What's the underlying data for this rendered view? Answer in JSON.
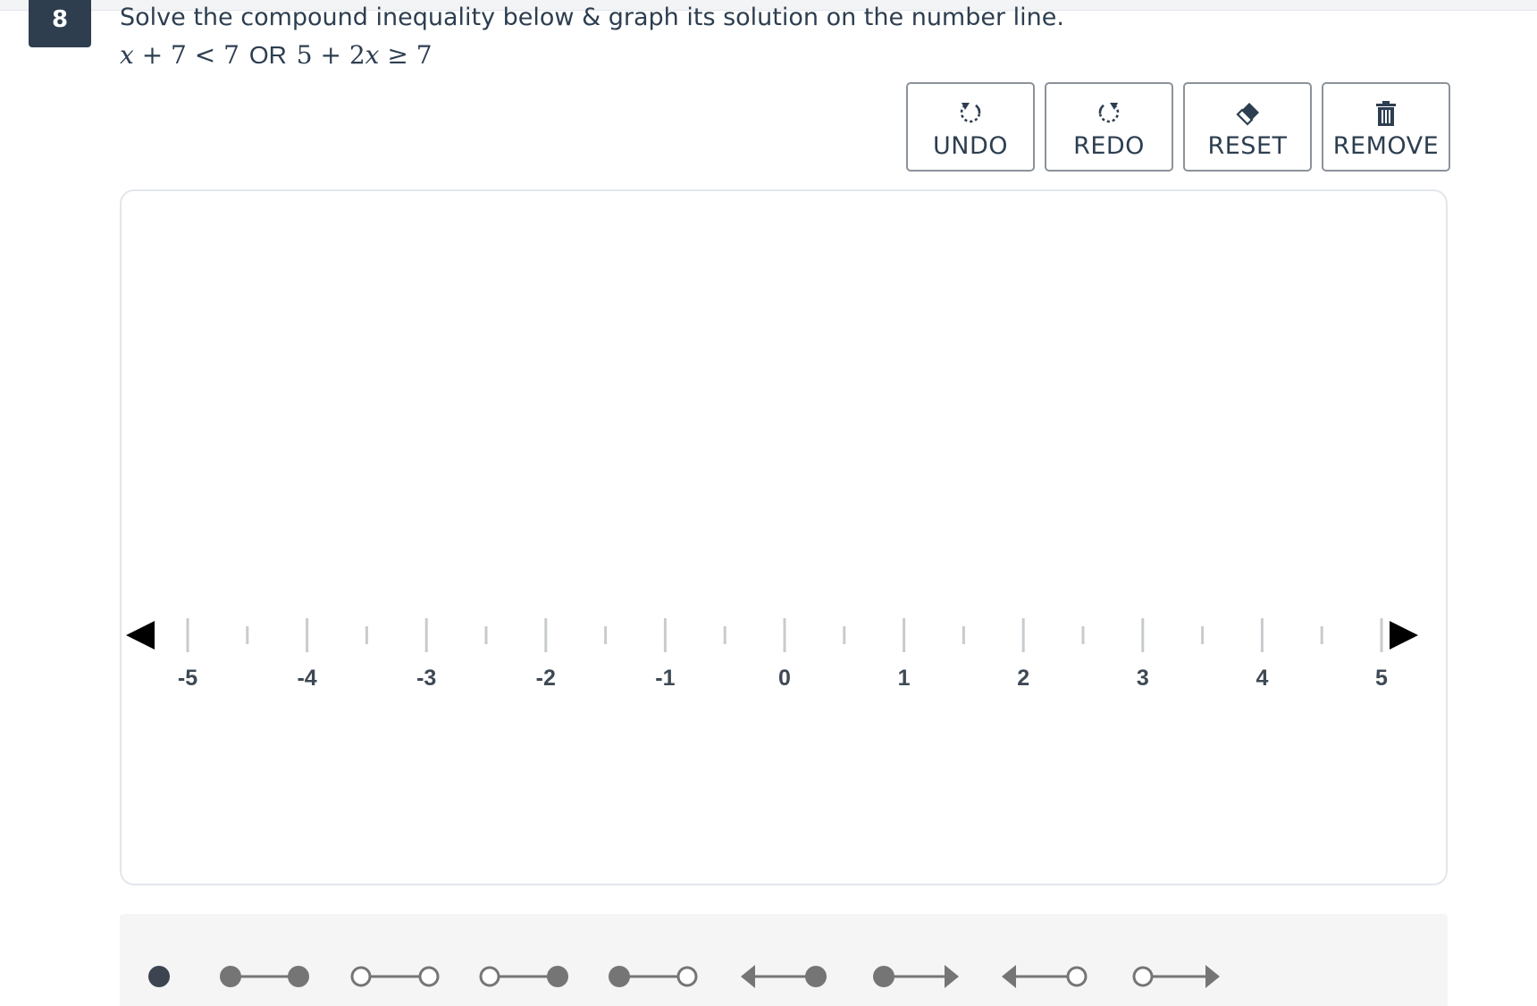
{
  "question": {
    "number": "8",
    "prompt": "Solve the compound inequality below & graph its solution on the number line.",
    "equation": {
      "left_var": "x",
      "left_rest": " + 7 < 7 ",
      "connector": "OR",
      "right_lead": " 5 + 2",
      "right_var": "x",
      "right_rest": " ≥ 7"
    }
  },
  "toolbar": {
    "undo": {
      "label": "UNDO",
      "icon": "undo-icon"
    },
    "redo": {
      "label": "REDO",
      "icon": "redo-icon"
    },
    "reset": {
      "label": "RESET",
      "icon": "eraser-icon"
    },
    "remove": {
      "label": "REMOVE",
      "icon": "trash-icon"
    }
  },
  "number_line": {
    "min": -5,
    "max": 5,
    "minor_step": 0.5,
    "tick_labels": [
      "-5",
      "-4",
      "-3",
      "-2",
      "-1",
      "0",
      "1",
      "2",
      "3",
      "4",
      "5"
    ],
    "left_arrow_icon": "arrow-left-icon",
    "right_arrow_icon": "arrow-right-icon"
  },
  "tray": {
    "tools": [
      {
        "name": "closed-point"
      },
      {
        "name": "segment-closed-closed"
      },
      {
        "name": "segment-open-open"
      },
      {
        "name": "segment-open-closed"
      },
      {
        "name": "segment-closed-open"
      },
      {
        "name": "ray-left-closed"
      },
      {
        "name": "ray-right-closed"
      },
      {
        "name": "ray-left-open"
      },
      {
        "name": "ray-right-open"
      }
    ]
  },
  "colors": {
    "badge": "#2f3e4f",
    "text": "#2d3e50",
    "tick": "#c8cbce",
    "label": "#3f4954",
    "tool_gray": "#757575",
    "selected_point": "#3c4452"
  }
}
